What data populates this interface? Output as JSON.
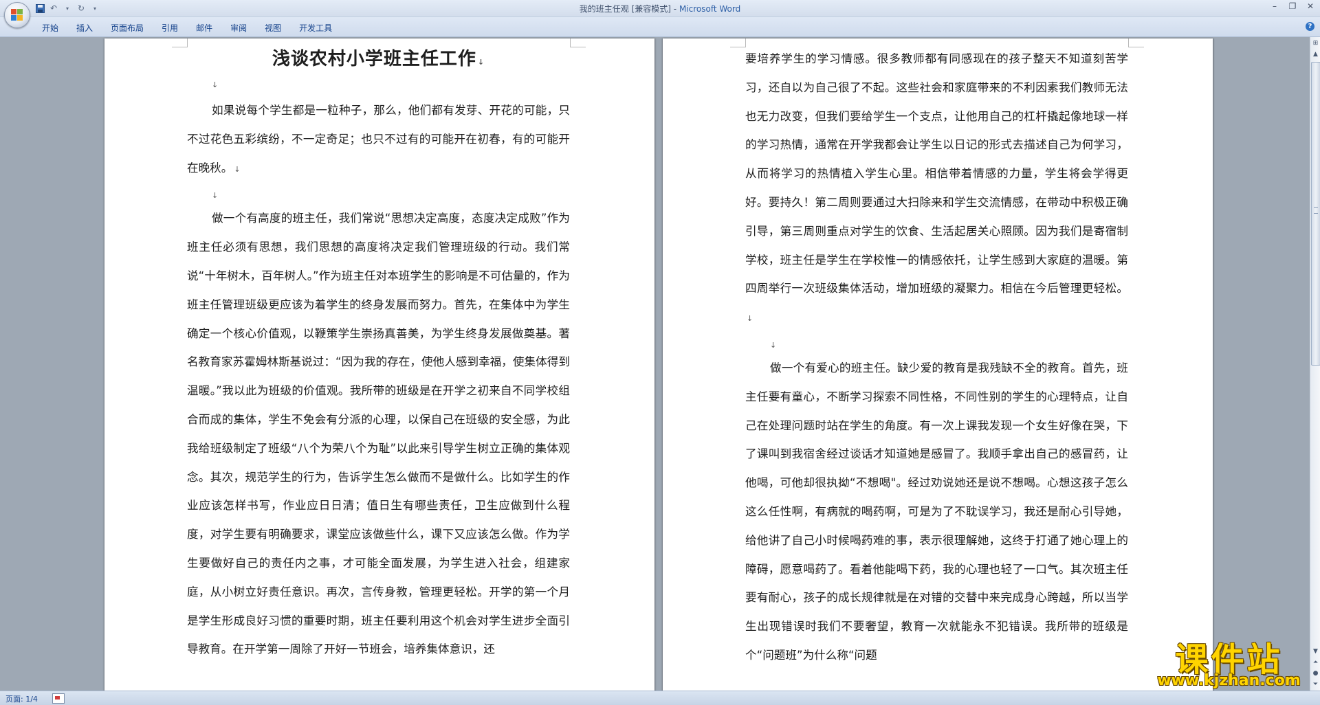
{
  "window": {
    "title_doc": "我的班主任观 [兼容模式]",
    "title_sep": " - ",
    "title_app": "Microsoft Word"
  },
  "ribbon": {
    "tabs": [
      "开始",
      "插入",
      "页面布局",
      "引用",
      "邮件",
      "审阅",
      "视图",
      "开发工具"
    ]
  },
  "document": {
    "title": "浅谈农村小学班主任工作",
    "page1": {
      "paragraphs": [
        "如果说每个学生都是一粒种子，那么，他们都有发芽、开花的可能，只不过花色五彩缤纷，不一定奇足；也只不过有的可能开在初春，有的可能开在晚秋。",
        "做一个有高度的班主任，我们常说“思想决定高度，态度决定成败”作为班主任必须有思想，我们思想的高度将决定我们管理班级的行动。我们常说“十年树木，百年树人。”作为班主任对本班学生的影响是不可估量的，作为班主任管理班级更应该为着学生的终身发展而努力。首先，在集体中为学生确定一个核心价值观，以鞭策学生崇扬真善美，为学生终身发展做奠基。著名教育家苏霍姆林斯基说过：“因为我的存在，使他人感到幸福，使集体得到温暖。”我以此为班级的价值观。我所带的班级是在开学之初来自不同学校组合而成的集体，学生不免会有分派的心理，以保自己在班级的安全感，为此我给班级制定了班级“八个为荣八个为耻”以此来引导学生树立正确的集体观念。其次，规范学生的行为，告诉学生怎么做而不是做什么。比如学生的作业应该怎样书写，作业应日日清；值日生有哪些责任，卫生应做到什么程度，对学生要有明确要求，课堂应该做些什么，课下又应该怎么做。作为学生要做好自己的责任内之事，才可能全面发展，为学生进入社会，组建家庭，从小树立好责任意识。再次，言传身教，管理更轻松。开学的第一个月是学生形成良好习惯的重要时期，班主任要利用这个机会对学生进步全面引导教育。在开学第一周除了开好一节班会，培养集体意识，还"
      ]
    },
    "page2": {
      "paragraphs": [
        "要培养学生的学习情感。很多教师都有同感现在的孩子整天不知道刻苦学习，还自以为自己很了不起。这些社会和家庭带来的不利因素我们教师无法也无力改变，但我们要给学生一个支点，让他用自己的杠杆撬起像地球一样的学习热情，通常在开学我都会让学生以日记的形式去描述自己为何学习，从而将学习的热情植入学生心里。相信带着情感的力量，学生将会学得更好。要持久！第二周则要通过大扫除来和学生交流情感，在带动中积极正确引导，第三周则重点对学生的饮食、生活起居关心照顾。因为我们是寄宿制学校，班主任是学生在学校惟一的情感依托，让学生感到大家庭的温暖。第四周举行一次班级集体活动，增加班级的凝聚力。相信在今后管理更轻松。",
        "做一个有爱心的班主任。缺少爱的教育是我残缺不全的教育。首先，班主任要有童心，不断学习探索不同性格，不同性别的学生的心理特点，让自己在处理问题时站在学生的角度。有一次上课我发现一个女生好像在哭，下了课叫到我宿舍经过谈话才知道她是感冒了。我顺手拿出自己的感冒药，让他喝，可他却很执拗“不想喝\"。经过劝说她还是说不想喝。心想这孩子怎么这么任性啊，有病就的喝药啊，可是为了不耽误学习，我还是耐心引导她，给他讲了自己小时候喝药难的事，表示很理解她，这终于打通了她心理上的障碍，愿意喝药了。看着他能喝下药，我的心理也轻了一口气。其次班主任要有耐心，孩子的成长规律就是在对错的交替中来完成身心跨越，所以当学生出现错误时我们不要奢望，教育一次就能永不犯错误。我所带的班级是个“问题班”为什么称“问题"
      ]
    },
    "paragraph_mark": "↓"
  },
  "status": {
    "page_count": "页面: 1/4"
  },
  "watermark": {
    "main": "课件站",
    "url": "www.kjzhan.com"
  }
}
